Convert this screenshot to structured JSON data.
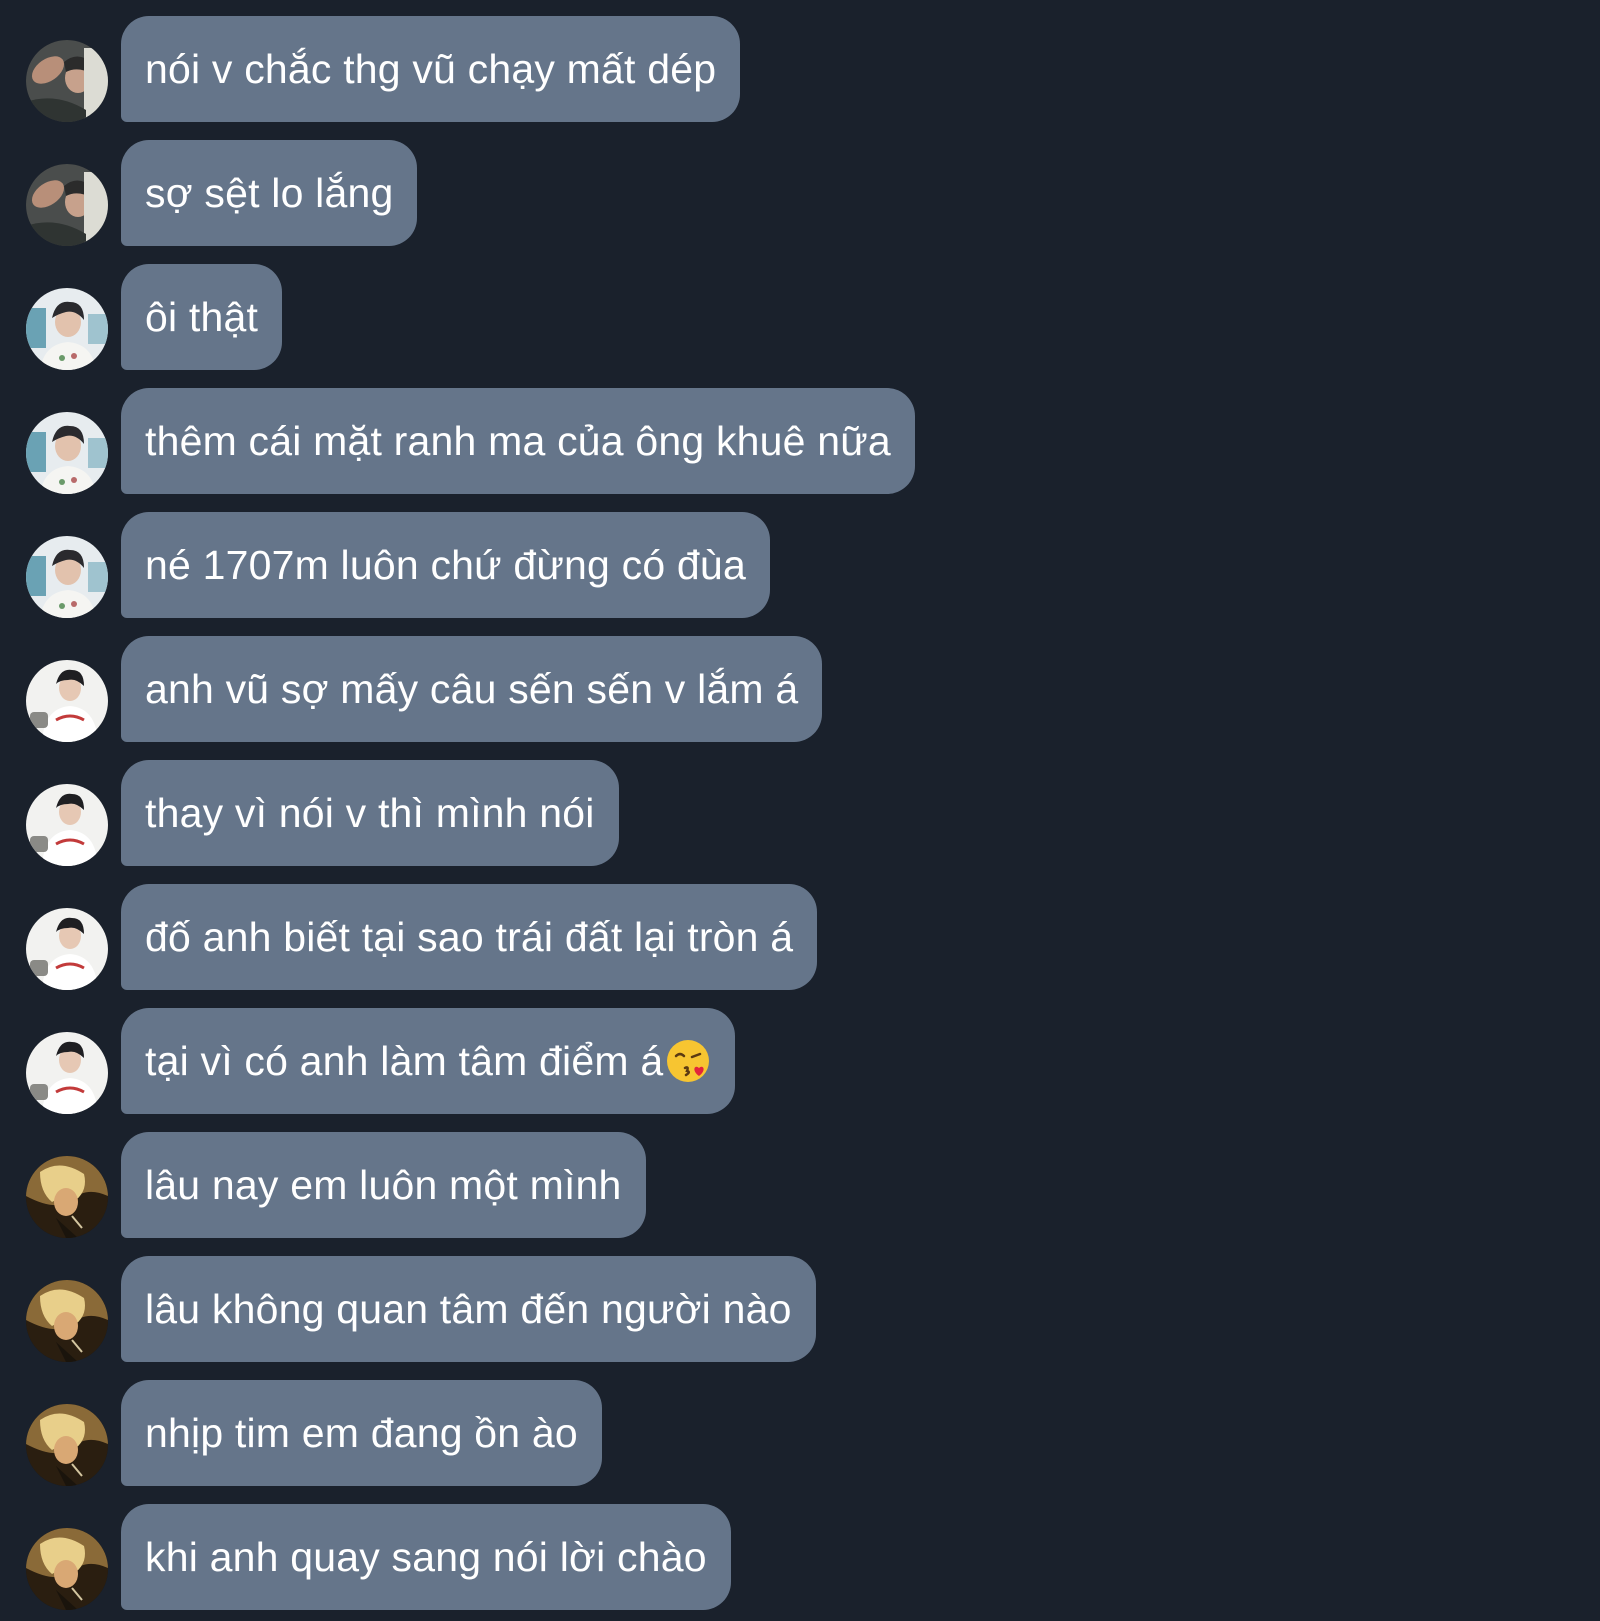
{
  "messages": [
    {
      "avatar": "avatar-user-a",
      "text": "nói v chắc thg vũ chạy mất dép"
    },
    {
      "avatar": "avatar-user-a",
      "text": "sợ sệt lo lắng"
    },
    {
      "avatar": "avatar-user-b",
      "text": "ôi thật"
    },
    {
      "avatar": "avatar-user-b",
      "text": "thêm cái mặt ranh ma của ông khuê nữa"
    },
    {
      "avatar": "avatar-user-b",
      "text": "né 1707m luôn chứ đừng có đùa"
    },
    {
      "avatar": "avatar-user-c",
      "text": "anh vũ sợ mấy câu sến sến v lắm á"
    },
    {
      "avatar": "avatar-user-c",
      "text": "thay vì nói v thì mình nói"
    },
    {
      "avatar": "avatar-user-c",
      "text": "đố anh biết tại sao trái đất lại tròn á"
    },
    {
      "avatar": "avatar-user-c",
      "text": "tại vì có anh làm tâm điểm á",
      "emoji": "face-blowing-kiss-emoji"
    },
    {
      "avatar": "avatar-user-d",
      "text": "lâu nay em luôn một mình"
    },
    {
      "avatar": "avatar-user-d",
      "text": "lâu không quan tâm đến người nào"
    },
    {
      "avatar": "avatar-user-d",
      "text": "nhịp tim em đang ồn ào"
    },
    {
      "avatar": "avatar-user-d",
      "text": "khi anh quay sang nói lời chào"
    }
  ],
  "colors": {
    "background": "#1a212c",
    "bubble": "#65758a",
    "text": "#ffffff"
  }
}
